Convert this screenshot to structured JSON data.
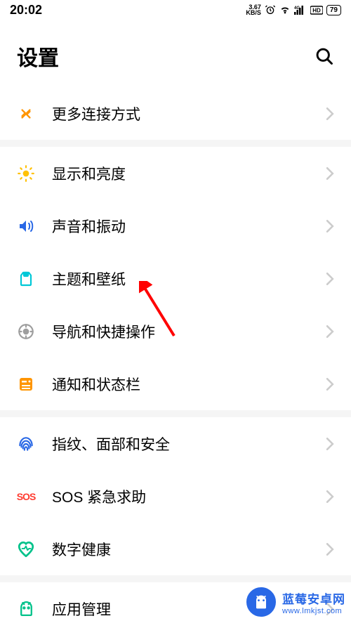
{
  "status": {
    "time": "20:02",
    "speed_value": "3.67",
    "speed_unit": "KB/S",
    "battery": "79"
  },
  "header": {
    "title": "设置"
  },
  "items": {
    "more_connections": "更多连接方式",
    "display": "显示和亮度",
    "sound": "声音和振动",
    "theme": "主题和壁纸",
    "navigation": "导航和快捷操作",
    "notification": "通知和状态栏",
    "security": "指纹、面部和安全",
    "sos": "SOS 紧急求助",
    "digital_health": "数字健康",
    "app_management": "应用管理"
  },
  "watermark": {
    "name": "蓝莓安卓网",
    "url": "www.lmkjst.com"
  }
}
